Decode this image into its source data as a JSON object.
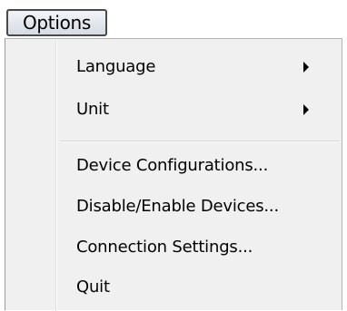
{
  "menubar": {
    "options_label": "Options"
  },
  "menu": {
    "items": [
      {
        "label": "Language",
        "has_submenu": true
      },
      {
        "label": "Unit",
        "has_submenu": true
      },
      {
        "label": "Device Configurations...",
        "has_submenu": false
      },
      {
        "label": "Disable/Enable Devices...",
        "has_submenu": false
      },
      {
        "label": "Connection Settings...",
        "has_submenu": false
      },
      {
        "label": "Quit",
        "has_submenu": false
      }
    ],
    "submenu_icon": "chevron-right-icon"
  },
  "colors": {
    "menu_background": "#f0f0f0",
    "menubar_highlight": "#d6dbe4",
    "text": "#000000"
  }
}
